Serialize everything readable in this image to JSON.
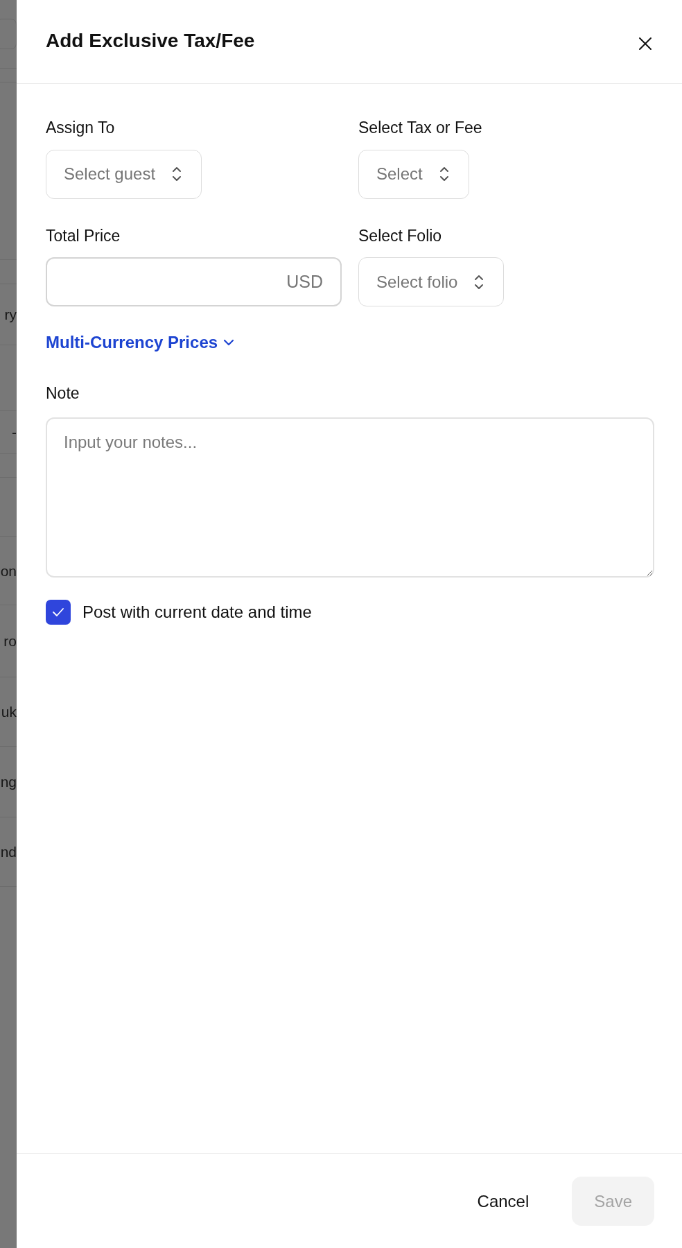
{
  "backdrop": {
    "row_texts": [
      "ry",
      "-",
      "on",
      "ro",
      "uk",
      "ng",
      "nd"
    ]
  },
  "dialog": {
    "title": "Add Exclusive Tax/Fee",
    "fields": [
      {
        "kind": "select",
        "label": "Assign To",
        "placeholder": "Select guest"
      },
      {
        "kind": "select",
        "label": "Select Tax or Fee",
        "placeholder": "Select"
      },
      {
        "kind": "amount",
        "label": "Total Price",
        "suffix": "USD"
      },
      {
        "kind": "select",
        "label": "Select Folio",
        "placeholder": "Select folio"
      }
    ],
    "multi_currency_link": {
      "label": "Multi-Currency Prices",
      "expanded": false
    },
    "note": {
      "label": "Note",
      "placeholder": "Input your notes..."
    },
    "post_now": {
      "label": "Post with current date and time",
      "checked": true
    },
    "buttons": [
      {
        "label": "Cancel",
        "kind": "secondary",
        "disabled": false
      },
      {
        "label": "Save",
        "kind": "primary",
        "disabled": true
      }
    ]
  }
}
